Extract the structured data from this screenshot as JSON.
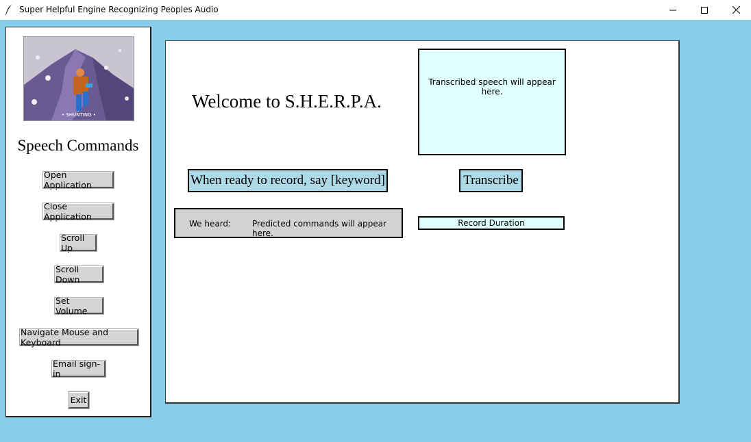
{
  "window": {
    "title": "Super Helpful Engine Recognizing Peoples Audio"
  },
  "sidebar": {
    "heading": "Speech Commands",
    "hero_caption": "• SHUNTING •",
    "buttons": [
      {
        "label": "Open Application"
      },
      {
        "label": "Close Application"
      },
      {
        "label": "Scroll Up"
      },
      {
        "label": "Scroll Down"
      },
      {
        "label": "Set Volume"
      },
      {
        "label": "Navigate Mouse and Keyboard"
      },
      {
        "label": "Email sign-in"
      },
      {
        "label": "Exit"
      }
    ]
  },
  "main": {
    "welcome": "Welcome to S.H.E.R.P.A.",
    "transcript_placeholder": "Transcribed speech will appear here.",
    "record_prompt": "When ready to record, say [keyword]",
    "transcribe_label": "Transcribe",
    "heard_label": "We heard:",
    "heard_value": "Predicted commands will appear here.",
    "duration_label": "Record Duration"
  },
  "colors": {
    "window_bg": "#87ceeb",
    "light_cyan": "#e0ffff",
    "light_blue": "#add8e6",
    "gray": "#d3d3d3"
  }
}
